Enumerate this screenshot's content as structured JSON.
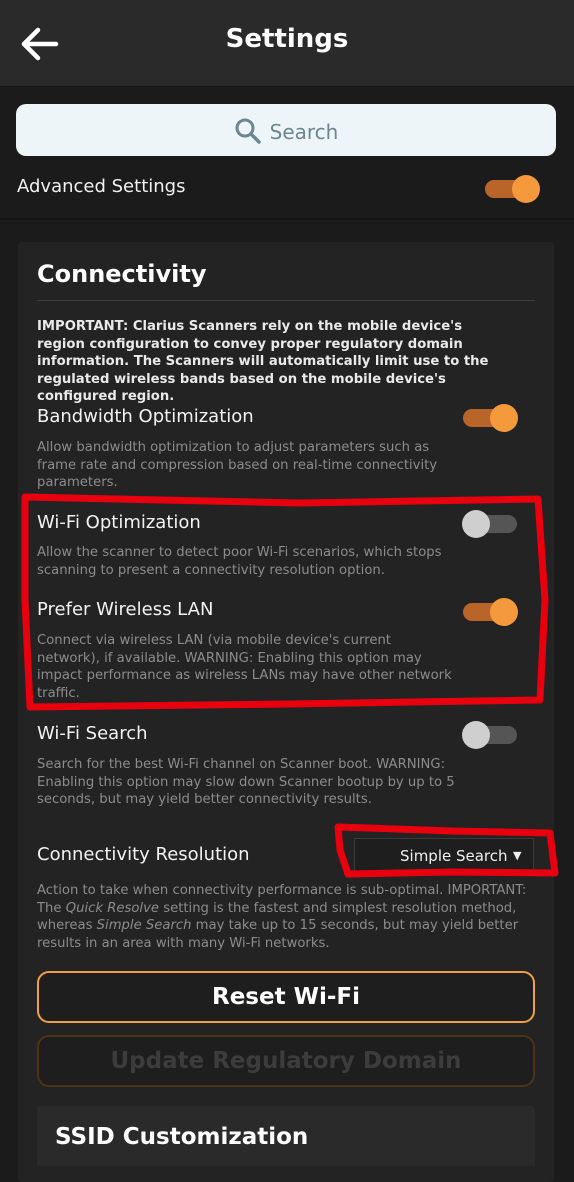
{
  "header": {
    "title": "Settings"
  },
  "search": {
    "placeholder": "Search"
  },
  "advanced": {
    "label": "Advanced Settings",
    "enabled": true
  },
  "connectivity": {
    "title": "Connectivity",
    "important": "IMPORTANT: Clarius Scanners rely on the mobile device's region configuration to convey proper regulatory domain information. The Scanners will automatically limit use to the regulated wireless bands based on the mobile device's configured region.",
    "settings": [
      {
        "label": "Bandwidth Optimization",
        "desc": "Allow bandwidth optimization to adjust parameters such as frame rate and compression based on real-time connectivity parameters.",
        "enabled": true
      },
      {
        "label": "Wi-Fi Optimization",
        "desc": "Allow the scanner to detect poor Wi-Fi scenarios, which stops scanning to present a connectivity resolution option.",
        "enabled": false
      },
      {
        "label": "Prefer Wireless LAN",
        "desc": "Connect via wireless LAN (via mobile device's current network), if available. WARNING: Enabling this option may impact performance as wireless LANs may have other network traffic.",
        "enabled": true
      },
      {
        "label": "Wi-Fi Search",
        "desc": "Search for the best Wi-Fi channel on Scanner boot. WARNING: Enabling this option may slow down Scanner bootup by up to 5 seconds, but may yield better connectivity results.",
        "enabled": false
      }
    ],
    "resolution": {
      "label": "Connectivity Resolution",
      "selected": "Simple Search",
      "caret": "▼",
      "desc_a": "Action to take when connectivity performance is sub-optimal. IMPORTANT: The ",
      "desc_em1": "Quick Resolve",
      "desc_b": " setting is the fastest and simplest resolution method, whereas ",
      "desc_em2": "Simple Search",
      "desc_c": " may take up to 15 seconds, but may yield better results in an area with many Wi-Fi networks."
    },
    "reset_button": "Reset Wi-Fi",
    "update_button": "Update Regulatory Domain"
  },
  "ssid": {
    "title": "SSID Customization"
  },
  "colors": {
    "accent": "#f59a3c",
    "track_on": "#b9652a",
    "annotation": "#e8000f"
  }
}
